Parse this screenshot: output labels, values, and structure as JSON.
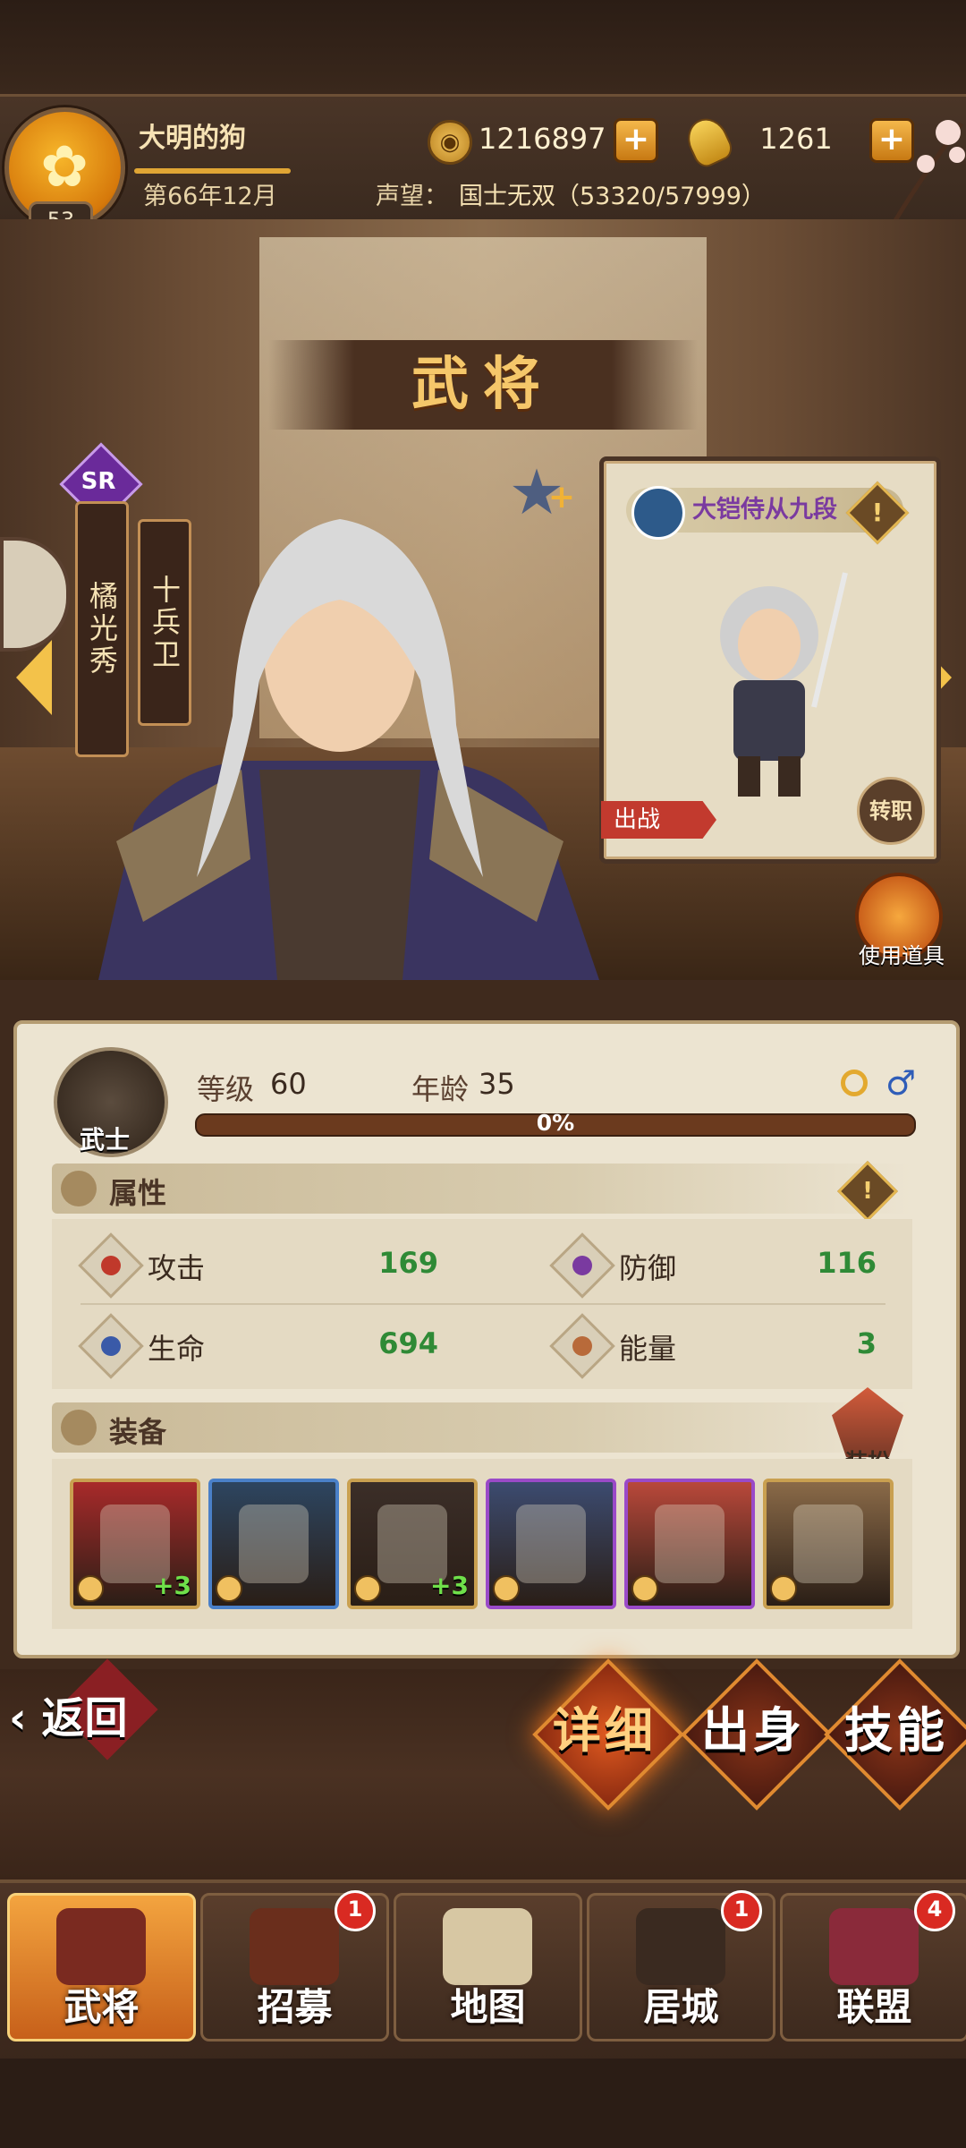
{
  "header": {
    "player_name": "大明的狗",
    "player_level": "53",
    "coins": "1216897",
    "gold": "1261",
    "date": "第66年12月",
    "prestige_label": "声望：",
    "prestige_value": "国士无双（53320/57999）"
  },
  "page": {
    "title": "武将"
  },
  "hero": {
    "rarity": "SR",
    "name": "橘光秀",
    "alias": "十兵卫",
    "class_name": "大铠侍从九段",
    "deploy_label": "出战",
    "transfer_label": "转职",
    "use_item_label": "使用道具"
  },
  "info": {
    "class_badge": "武士",
    "level_label": "等级",
    "level_value": "60",
    "age_label": "年龄",
    "age_value": "35",
    "xp_text": "0%",
    "xp_fraction": 0
  },
  "attributes": {
    "title": "属性",
    "attack_label": "攻击",
    "attack_value": "169",
    "defense_label": "防御",
    "defense_value": "116",
    "hp_label": "生命",
    "hp_value": "694",
    "energy_label": "能量",
    "energy_value": "3"
  },
  "equipment": {
    "title": "装备",
    "dress_up_label": "装扮",
    "slots": [
      {
        "name": "sword",
        "upgrade": "+3",
        "rarity_color": "#c9a050"
      },
      {
        "name": "gauntlet",
        "upgrade": "",
        "rarity_color": "#4a80c8"
      },
      {
        "name": "helmet",
        "upgrade": "+3",
        "rarity_color": "#c9a050"
      },
      {
        "name": "armor",
        "upgrade": "",
        "rarity_color": "#9a4ac8"
      },
      {
        "name": "skirt-armor",
        "upgrade": "",
        "rarity_color": "#9a4ac8"
      },
      {
        "name": "boots",
        "upgrade": "",
        "rarity_color": "#c9a050"
      }
    ]
  },
  "actions": {
    "back": "返回",
    "detail": "详细",
    "origin": "出身",
    "skill": "技能"
  },
  "nav": {
    "tabs": [
      {
        "label": "武将",
        "badge": "",
        "active": true
      },
      {
        "label": "招募",
        "badge": "1",
        "active": false
      },
      {
        "label": "地图",
        "badge": "",
        "active": false
      },
      {
        "label": "居城",
        "badge": "1",
        "active": false
      },
      {
        "label": "联盟",
        "badge": "4",
        "active": false
      }
    ]
  }
}
